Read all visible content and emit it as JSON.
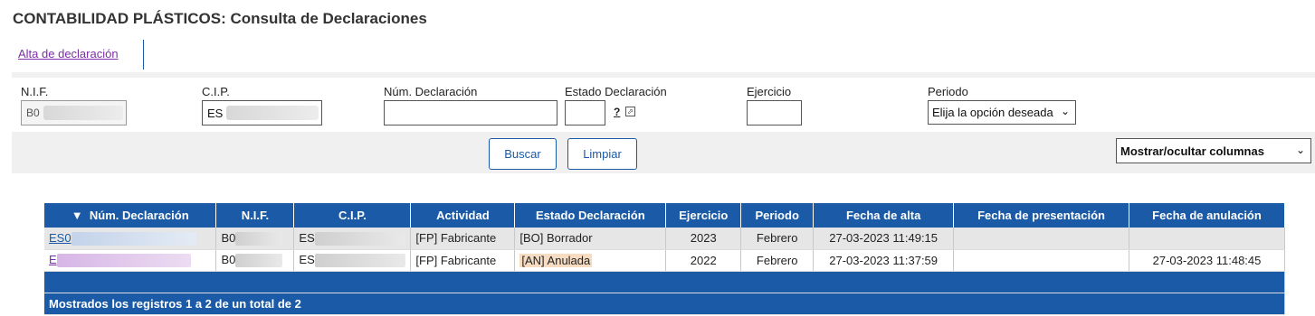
{
  "page": {
    "title": "CONTABILIDAD PLÁSTICOS: Consulta de Declaraciones"
  },
  "tabs": {
    "new_declaration": "Alta de declaración"
  },
  "filters": {
    "nif": {
      "label": "N.I.F.",
      "value": "B0"
    },
    "cip": {
      "label": "C.I.P.",
      "value": "ES"
    },
    "num_declaracion": {
      "label": "Núm. Declaración",
      "value": ""
    },
    "estado": {
      "label": "Estado Declaración",
      "value": "",
      "help": "?"
    },
    "ejercicio": {
      "label": "Ejercicio",
      "value": ""
    },
    "periodo": {
      "label": "Periodo",
      "selected": "Elija la opción deseada"
    }
  },
  "actions": {
    "search": "Buscar",
    "clear": "Limpiar",
    "columns_toggle": "Mostrar/ocultar columnas"
  },
  "table": {
    "sort_indicator": "▼",
    "headers": [
      "Núm. Declaración",
      "N.I.F.",
      "C.I.P.",
      "Actividad",
      "Estado Declaración",
      "Ejercicio",
      "Periodo",
      "Fecha de alta",
      "Fecha de presentación",
      "Fecha de anulación"
    ],
    "rows": [
      {
        "num": "ES0",
        "nif": "B0",
        "cip": "ES",
        "actividad": "[FP] Fabricante",
        "estado": "[BO] Borrador",
        "ejercicio": "2023",
        "periodo": "Febrero",
        "fecha_alta": "27-03-2023 11:49:15",
        "fecha_presentacion": "",
        "fecha_anulacion": ""
      },
      {
        "num": "E",
        "nif": "B0",
        "cip": "ES",
        "actividad": "[FP] Fabricante",
        "estado": "[AN] Anulada",
        "ejercicio": "2022",
        "periodo": "Febrero",
        "fecha_alta": "27-03-2023 11:37:59",
        "fecha_presentacion": "",
        "fecha_anulacion": "27-03-2023 11:48:45"
      }
    ],
    "footer": "Mostrados los registros 1 a 2 de un total de 2"
  },
  "colors": {
    "primary": "#1a5aa6",
    "visited_link": "#7a2fa6",
    "annulled_highlight": "#f7dcc2"
  }
}
